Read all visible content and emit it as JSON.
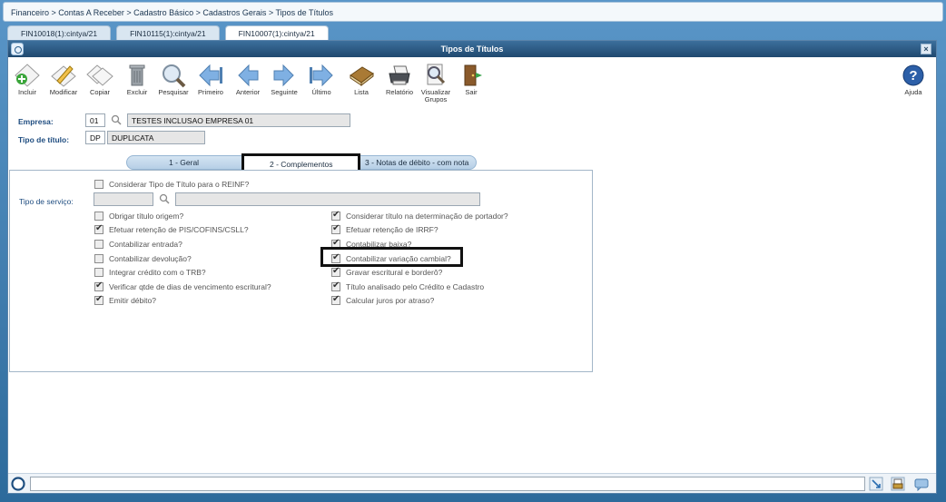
{
  "breadcrumb": "Financeiro > Contas A Receber > Cadastro Básico > Cadastros Gerais > Tipos de Títulos",
  "tabs": [
    {
      "label": "FIN10018(1):cintya/21",
      "active": false
    },
    {
      "label": "FIN10115(1):cintya/21",
      "active": false
    },
    {
      "label": "FIN10007(1):cintya/21",
      "active": true
    }
  ],
  "window": {
    "title": "Tipos de Títulos",
    "close": "×"
  },
  "toolbar": {
    "items": [
      {
        "label": "Incluir",
        "icon": "add-diamond-icon"
      },
      {
        "label": "Modificar",
        "icon": "edit-pencil-icon"
      },
      {
        "label": "Copiar",
        "icon": "copy-diamond-icon"
      },
      {
        "label": "Excluir",
        "icon": "trash-icon"
      },
      {
        "label": "Pesquisar",
        "icon": "magnifier-icon"
      },
      {
        "label": "Primeiro",
        "icon": "first-arrow-icon"
      },
      {
        "label": "Anterior",
        "icon": "previous-arrow-icon"
      },
      {
        "label": "Seguinte",
        "icon": "next-arrow-icon"
      },
      {
        "label": "Último",
        "icon": "last-arrow-icon"
      },
      {
        "label": "Lista",
        "icon": "list-book-icon"
      },
      {
        "label": "Relatório",
        "icon": "printer-icon"
      },
      {
        "label": "Visualizar Grupos",
        "icon": "view-groups-icon"
      },
      {
        "label": "Sair",
        "icon": "exit-door-icon"
      }
    ],
    "help": {
      "label": "Ajuda",
      "icon": "help-icon"
    }
  },
  "form": {
    "empresa_label": "Empresa:",
    "empresa_code": "01",
    "empresa_name": "TESTES INCLUSAO EMPRESA 01",
    "tipo_label": "Tipo de título:",
    "tipo_code": "DP",
    "tipo_name": "DUPLICATA"
  },
  "subtabs": [
    {
      "label": "1 - Geral",
      "active": false
    },
    {
      "label": "2 - Complementos",
      "active": true
    },
    {
      "label": "3 - Notas de débito - com nota",
      "active": false
    }
  ],
  "complementos": {
    "reinf": {
      "label": "Considerar Tipo de Título para o REINF?",
      "checked": false
    },
    "tipo_servico_label": "Tipo de serviço:",
    "tipo_servico_code": "",
    "tipo_servico_desc": "",
    "left": [
      {
        "label": "Obrigar título origem?",
        "checked": false
      },
      {
        "label": "Efetuar retenção de PIS/COFINS/CSLL?",
        "checked": true
      },
      {
        "label": "Contabilizar entrada?",
        "checked": false
      },
      {
        "label": "Contabilizar devolução?",
        "checked": false
      },
      {
        "label": "Integrar crédito com o TRB?",
        "checked": false
      },
      {
        "label": "Verificar qtde de dias de vencimento escritural?",
        "checked": true
      },
      {
        "label": "Emitir débito?",
        "checked": true
      }
    ],
    "right": [
      {
        "label": "Considerar título na determinação de portador?",
        "checked": true
      },
      {
        "label": "Efetuar retenção de IRRF?",
        "checked": true
      },
      {
        "label": "Contabilizar baixa?",
        "checked": true
      },
      {
        "label": "Contabilizar variação cambial?",
        "checked": true
      },
      {
        "label": "Gravar escritural e borderô?",
        "checked": true
      },
      {
        "label": "Título analisado pelo Crédito e Cadastro",
        "checked": true
      },
      {
        "label": "Calcular juros por atraso?",
        "checked": true
      }
    ]
  },
  "status": {
    "text": ""
  }
}
